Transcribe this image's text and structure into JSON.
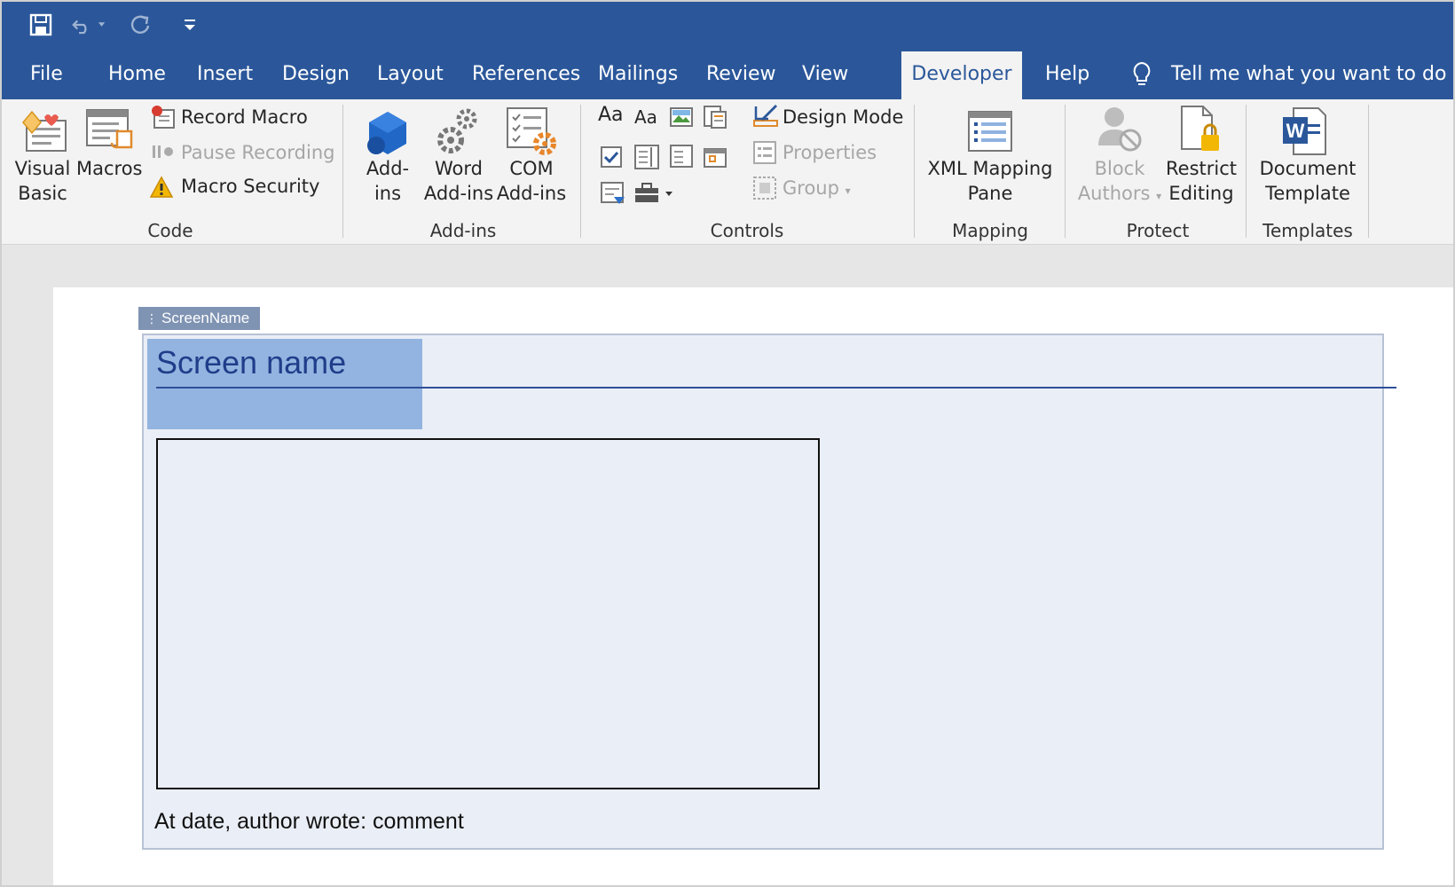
{
  "tabs": [
    {
      "label": "File"
    },
    {
      "label": "Home"
    },
    {
      "label": "Insert"
    },
    {
      "label": "Design"
    },
    {
      "label": "Layout"
    },
    {
      "label": "References"
    },
    {
      "label": "Mailings"
    },
    {
      "label": "Review"
    },
    {
      "label": "View"
    },
    {
      "label": "Developer"
    },
    {
      "label": "Help"
    }
  ],
  "active_tab": "Developer",
  "tell_me": "Tell me what you want to do",
  "ribbon": {
    "code": {
      "group": "Code",
      "visual_basic": [
        "Visual",
        "Basic"
      ],
      "macros": "Macros",
      "record_macro": "Record Macro",
      "pause_recording": "Pause Recording",
      "macro_security": "Macro Security"
    },
    "addins": {
      "group": "Add-ins",
      "addins": [
        "Add-",
        "ins"
      ],
      "word_addins": [
        "Word",
        "Add-ins"
      ],
      "com_addins": [
        "COM",
        "Add-ins"
      ]
    },
    "controls": {
      "group": "Controls",
      "design_mode": "Design Mode",
      "properties": "Properties",
      "group_btn": "Group",
      "rich_text": "Aa",
      "plain_text": "Aa"
    },
    "mapping": {
      "group": "Mapping",
      "xml_mapping": [
        "XML Mapping",
        "Pane"
      ]
    },
    "protect": {
      "group": "Protect",
      "block_authors": [
        "Block",
        "Authors"
      ],
      "restrict_editing": [
        "Restrict",
        "Editing"
      ]
    },
    "templates": {
      "group": "Templates",
      "document_template": [
        "Document",
        "Template"
      ]
    }
  },
  "document": {
    "content_control_tag": "ScreenName",
    "heading": "Screen name",
    "comment": "At date, author wrote: comment"
  },
  "colors": {
    "accent": "#2b579a",
    "ribbon_bg": "#f3f3f3",
    "heading": "#1f3d8a",
    "selection": "#93b4e0",
    "control_bg": "#eaeef6"
  }
}
